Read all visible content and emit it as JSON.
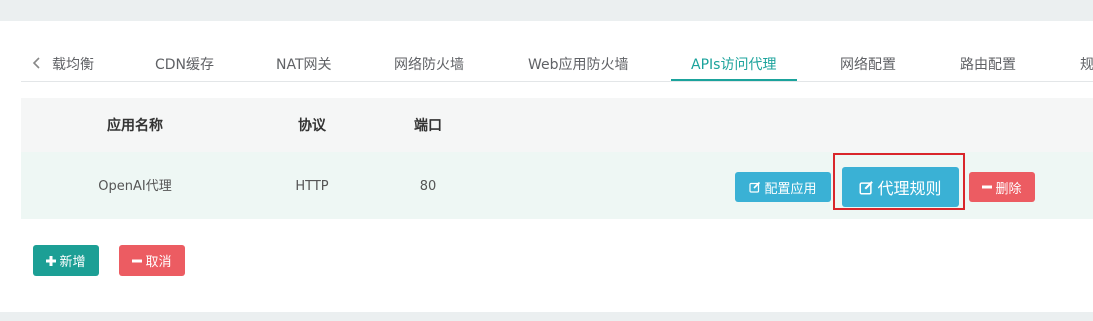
{
  "tabs": {
    "items": [
      {
        "label": "载均衡"
      },
      {
        "label": "CDN缓存"
      },
      {
        "label": "NAT网关"
      },
      {
        "label": "网络防火墙"
      },
      {
        "label": "Web应用防火墙"
      },
      {
        "label": "APIs访问代理"
      },
      {
        "label": "网络配置"
      },
      {
        "label": "路由配置"
      },
      {
        "label": "规"
      }
    ],
    "active": "APIs访问代理"
  },
  "table": {
    "headers": [
      "应用名称",
      "协议",
      "端口"
    ],
    "rows": [
      {
        "app_name": "OpenAI代理",
        "protocol": "HTTP",
        "port": "80"
      }
    ]
  },
  "row_actions": {
    "configure_label": "配置应用",
    "proxy_rules_label": "代理规则",
    "delete_label": "删除"
  },
  "footer_actions": {
    "add_label": "新增",
    "cancel_label": "取消"
  },
  "colors": {
    "accent": "#1ba39c",
    "info": "#3ab1d5",
    "danger": "#ec5c62",
    "success": "#1c9f95",
    "highlight": "#d9262b"
  },
  "icons": {
    "prev": "chevron-left-icon",
    "edit": "edit-icon",
    "minus": "minus-icon",
    "plus": "plus-icon"
  }
}
